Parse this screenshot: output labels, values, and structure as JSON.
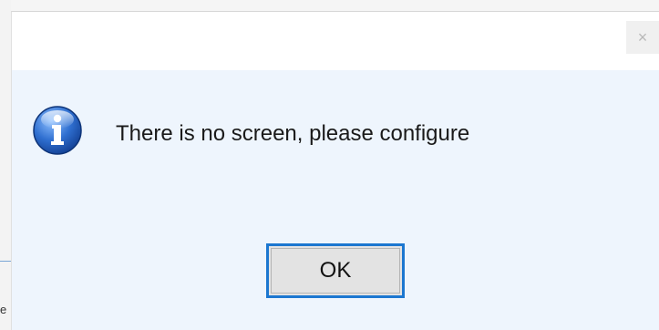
{
  "background": {
    "partial_text": "e"
  },
  "dialog": {
    "close_glyph": "×",
    "icon": "info-icon",
    "message": "There is no screen, please configure",
    "ok_label": "OK"
  },
  "colors": {
    "dialog_body": "#eef5fd",
    "titlebar": "#ffffff",
    "ok_border": "#1c77d0",
    "ok_face": "#e3e3e3",
    "icon_blue": "#2f6fd0"
  }
}
